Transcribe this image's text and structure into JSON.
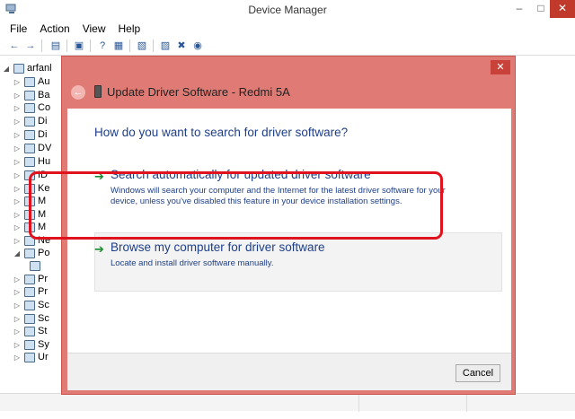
{
  "window": {
    "title": "Device Manager",
    "app_icon": "device-manager-icon",
    "minimize_glyph": "–",
    "maximize_glyph": "□",
    "close_glyph": "✕"
  },
  "menu": [
    "File",
    "Action",
    "View",
    "Help"
  ],
  "toolbar": {
    "icons": [
      "back-arrow-icon",
      "forward-arrow-icon",
      "show-hide-tree-icon",
      "properties-icon",
      "help-icon",
      "view-icon",
      "scan-hardware-icon",
      "update-driver-icon",
      "uninstall-icon",
      "disable-icon"
    ]
  },
  "tree": {
    "root_label": "arfanl",
    "items": [
      {
        "label": "Au",
        "icon": "audio-icon"
      },
      {
        "label": "Ba",
        "icon": "battery-icon"
      },
      {
        "label": "Co",
        "icon": "computer-icon"
      },
      {
        "label": "Di",
        "icon": "disk-icon"
      },
      {
        "label": "Di",
        "icon": "display-icon"
      },
      {
        "label": "DV",
        "icon": "dvd-icon"
      },
      {
        "label": "Hu",
        "icon": "hid-icon"
      },
      {
        "label": "ID",
        "icon": "ide-icon"
      },
      {
        "label": "Ke",
        "icon": "keyboard-icon"
      },
      {
        "label": "M",
        "icon": "memory-icon"
      },
      {
        "label": "M",
        "icon": "mouse-icon"
      },
      {
        "label": "M",
        "icon": "monitor-icon"
      },
      {
        "label": "Ne",
        "icon": "network-icon"
      },
      {
        "label": "Po",
        "icon": "portable-device-icon"
      },
      {
        "label": "",
        "icon": "phone-icon"
      },
      {
        "label": "Pr",
        "icon": "print-queue-icon"
      },
      {
        "label": "Pr",
        "icon": "processor-icon"
      },
      {
        "label": "Sc",
        "icon": "software-device-icon"
      },
      {
        "label": "Sc",
        "icon": "sound-icon"
      },
      {
        "label": "St",
        "icon": "storage-icon"
      },
      {
        "label": "Sy",
        "icon": "system-icon"
      },
      {
        "label": "Ur",
        "icon": "usb-icon"
      }
    ]
  },
  "dialog": {
    "title": "Update Driver Software - Redmi 5A",
    "close_glyph": "✕",
    "back_glyph": "←",
    "question": "How do you want to search for driver software?",
    "option_auto": {
      "title": "Search automatically for updated driver software",
      "description": "Windows will search your computer and the Internet for the latest driver software for your device, unless you've disabled this feature in your device installation settings."
    },
    "option_browse": {
      "title": "Browse my computer for driver software",
      "description": "Locate and install driver software manually."
    },
    "cancel_label": "Cancel"
  },
  "colors": {
    "dialog_frame": "#e07a74",
    "accent_text": "#1e3f88",
    "highlight": "#e0121e",
    "arrow_green": "#1b8a2e"
  }
}
